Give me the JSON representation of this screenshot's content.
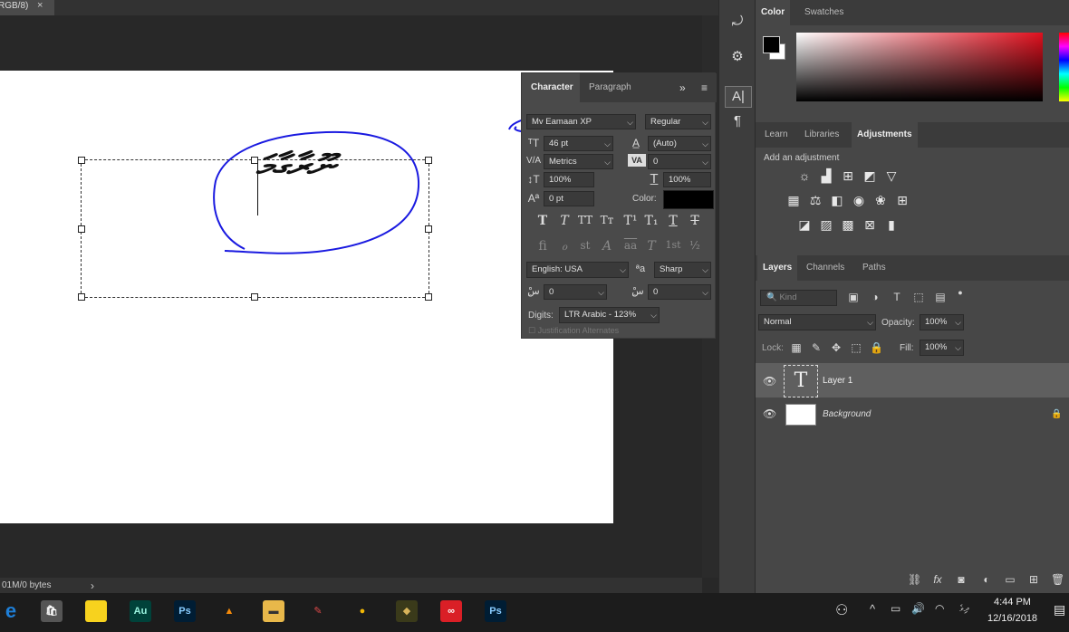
{
  "document": {
    "tab_title": "RGB/8)",
    "close_glyph": "×",
    "status_text": "01M/0 bytes",
    "status_arrow": "›"
  },
  "canvas_text": {
    "value": "ނޫރާގާމަ"
  },
  "character_panel": {
    "tabs": [
      "Character",
      "Paragraph"
    ],
    "expand_glyph": "»",
    "menu_glyph": "≡",
    "font_family": "Mv Eamaan XP",
    "font_style": "Regular",
    "font_size": "46 pt",
    "leading": "(Auto)",
    "kerning": "Metrics",
    "tracking": "0",
    "vertical_scale": "100%",
    "horizontal_scale": "100%",
    "baseline_shift": "0 pt",
    "color_label": "Color:",
    "color_value": "#000000",
    "style_buttons": [
      "T",
      "T",
      "TT",
      "Tт",
      "T¹",
      "T₁",
      "T",
      "T"
    ],
    "opentype_buttons": [
      "ﬁ",
      "ℴ",
      "st",
      "A",
      "aa",
      "T",
      "1st",
      "½"
    ],
    "language": "English: USA",
    "antialias_icon": "ªa",
    "antialias": "Sharp",
    "kashida_left": "0",
    "kashida_right": "0",
    "digits_label": "Digits:",
    "digits": "LTR Arabic - 123%",
    "justification_label": "Justification Alternates"
  },
  "color_panel": {
    "tabs": [
      "Color",
      "Swatches"
    ],
    "foreground": "#000000",
    "background": "#ffffff"
  },
  "adjustments_panel": {
    "tabs": [
      "Learn",
      "Libraries",
      "Adjustments"
    ],
    "add_label": "Add an adjustment"
  },
  "layers_panel": {
    "tabs": [
      "Layers",
      "Channels",
      "Paths"
    ],
    "filter_label": "Kind",
    "blend_mode": "Normal",
    "opacity_label": "Opacity:",
    "opacity": "100%",
    "lock_label": "Lock:",
    "fill_label": "Fill:",
    "fill": "100%",
    "layers": [
      {
        "name": "Layer 1",
        "type": "text",
        "selected": true
      },
      {
        "name": "Background",
        "type": "background",
        "locked": true
      }
    ]
  },
  "taskbar": {
    "time": "4:44 PM",
    "date": "12/16/2018",
    "apps": [
      {
        "name": "edge",
        "label": "e",
        "color": "#1e7fd8"
      },
      {
        "name": "store",
        "label": "🛍",
        "color": "#555555"
      },
      {
        "name": "sticky-notes",
        "label": "",
        "color": "#f7d21e"
      },
      {
        "name": "audition",
        "label": "Au",
        "color": "#00423a"
      },
      {
        "name": "photoshop",
        "label": "Ps",
        "color": "#001d34"
      },
      {
        "name": "vlc",
        "label": "▲",
        "color": "#1c1c1c"
      },
      {
        "name": "explorer",
        "label": "▬",
        "color": "#e8b84a"
      },
      {
        "name": "paint",
        "label": "✎",
        "color": "#1c1c1c"
      },
      {
        "name": "chrome",
        "label": "●",
        "color": "#1c1c1c"
      },
      {
        "name": "app-gold",
        "label": "◆",
        "color": "#3a3a1a"
      },
      {
        "name": "creative-cloud",
        "label": "∞",
        "color": "#da1f26"
      },
      {
        "name": "photoshop-2",
        "label": "Ps",
        "color": "#001d34"
      }
    ],
    "ime_indicator": "ދިވެ"
  }
}
